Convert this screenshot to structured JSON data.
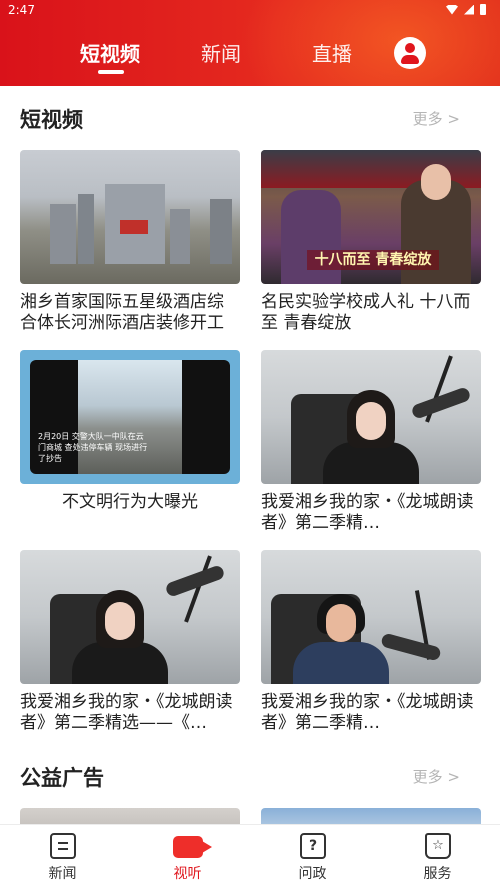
{
  "status_bar": {
    "time": "2:47"
  },
  "top_tabs": [
    "短视频",
    "新闻",
    "直播"
  ],
  "sections": {
    "short_video": {
      "title": "短视频",
      "more": "更多 >"
    },
    "public_ads": {
      "title": "公益广告",
      "more": "更多 >"
    }
  },
  "cards": [
    {
      "caption": "湘乡首家国际五星级酒店综合体长河洲际酒店装修开工"
    },
    {
      "caption": "名民实验学校成人礼 十八而至 青春绽放",
      "overlay": "十八而至 青春绽放"
    },
    {
      "caption": "不文明行为大曝光",
      "overlay": "2月20日 交警大队一中队在云门商城 查处违停车辆 现场进行了抄告"
    },
    {
      "caption": "我爱湘乡我的家・《龙城朗读者》第二季精…"
    },
    {
      "caption": "我爱湘乡我的家・《龙城朗读者》第二季精选——《…"
    },
    {
      "caption": "我爱湘乡我的家・《龙城朗读者》第二季精…"
    }
  ],
  "bottom_nav": [
    {
      "label": "新闻",
      "icon": "news-icon"
    },
    {
      "label": "视听",
      "icon": "video-icon"
    },
    {
      "label": "问政",
      "icon": "ask-icon"
    },
    {
      "label": "服务",
      "icon": "service-icon"
    }
  ],
  "colors": {
    "brand_red": "#e0161d",
    "active_red": "#ee2e2a"
  }
}
